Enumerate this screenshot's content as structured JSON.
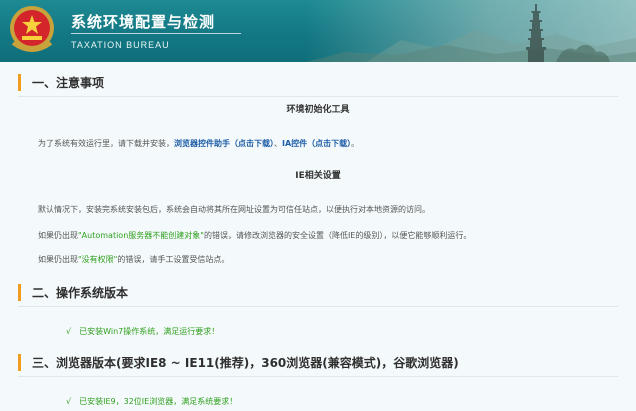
{
  "header": {
    "title": "系统环境配置与检测",
    "subtitle": "TAXATION BUREAU"
  },
  "sections": {
    "notice": {
      "heading": "一、注意事项",
      "init_tool": {
        "title": "环境初始化工具",
        "text_before": "为了系统有效运行里，请下载并安装，",
        "link1": "浏览器控件助手（点击下载）",
        "sep": "、",
        "link2": "IA控件（点击下载）",
        "text_after": "。"
      },
      "ie_settings": {
        "title": "IE相关设置",
        "para1": "默认情况下，安装完系统安装包后，系统会自动将其所在网址设置为可信任站点，以便执行对本地资源的访问。",
        "para2_before": "如果仍出现",
        "para2_highlight": "\"Automation服务器不能创建对象\"",
        "para2_after": "的错误，请修改浏览器的安全设置（降低IE的级别），以便它能够顺利运行。",
        "para3_before": "如果仍出现",
        "para3_highlight": "\"没有权限\"",
        "para3_after": "的错误，请手工设置受信站点。"
      }
    },
    "os": {
      "heading": "二、操作系统版本",
      "check": "√",
      "result": "已安装Win7操作系统，满足运行要求！"
    },
    "browser": {
      "heading": "三、浏览器版本(要求IE8 ~ IE11(推荐)，360浏览器(兼容模式)，谷歌浏览器)",
      "check": "√",
      "result": "已安装IE9，32位IE浏览器，满足系统要求！"
    }
  },
  "colors": {
    "header_bg": "#137884",
    "accent_bar": "#f29c1f",
    "link": "#1f5ea8",
    "success": "#2f9f1e"
  }
}
